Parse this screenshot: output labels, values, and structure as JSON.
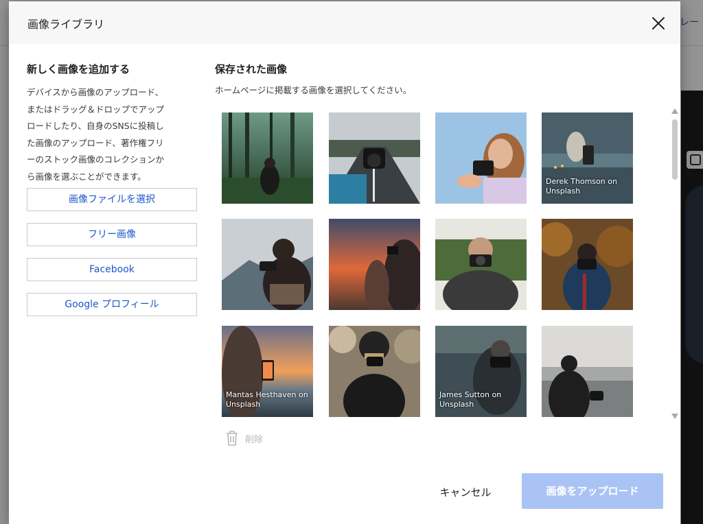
{
  "background": {
    "header_text": "グレー"
  },
  "modal": {
    "title": "画像ライブラリ"
  },
  "left": {
    "title": "新しく画像を追加する",
    "description": "デバイスから画像のアップロード、またはドラッグ＆ドロップでアップロードしたり、自身のSNSに投稿した画像のアップロード、著作権フリーのストック画像のコレクションから画像を選ぶことができます。",
    "desc_lines": [
      "デバイスから画像のアップロード、",
      "またはドラッグ＆ドロップでアップ",
      "ロードしたり、自身のSNSに投稿し",
      "た画像のアップロード、著作権フリ",
      "ーのストック画像のコレクションか",
      "ら画像を選ぶことができます。"
    ],
    "buttons": [
      "画像ファイルを選択",
      "フリー画像",
      "Facebook",
      "Google プロフィール"
    ]
  },
  "right": {
    "title": "保存された画像",
    "subtitle": "ホームページに掲載する画像を選択してください。"
  },
  "images": [
    {
      "caption": ""
    },
    {
      "caption": ""
    },
    {
      "caption": ""
    },
    {
      "caption": "Derek Thomson on Unsplash"
    },
    {
      "caption": ""
    },
    {
      "caption": ""
    },
    {
      "caption": ""
    },
    {
      "caption": ""
    },
    {
      "caption": "Mantas Hesthaven on Unsplash"
    },
    {
      "caption": ""
    },
    {
      "caption": "James Sutton on Unsplash"
    },
    {
      "caption": ""
    }
  ],
  "footer": {
    "delete_label": "削除",
    "cancel_label": "キャンセル",
    "upload_label": "画像をアップロード"
  },
  "colors": {
    "link_blue": "#1a56c9",
    "upload_disabled": "#a9c4f4"
  }
}
